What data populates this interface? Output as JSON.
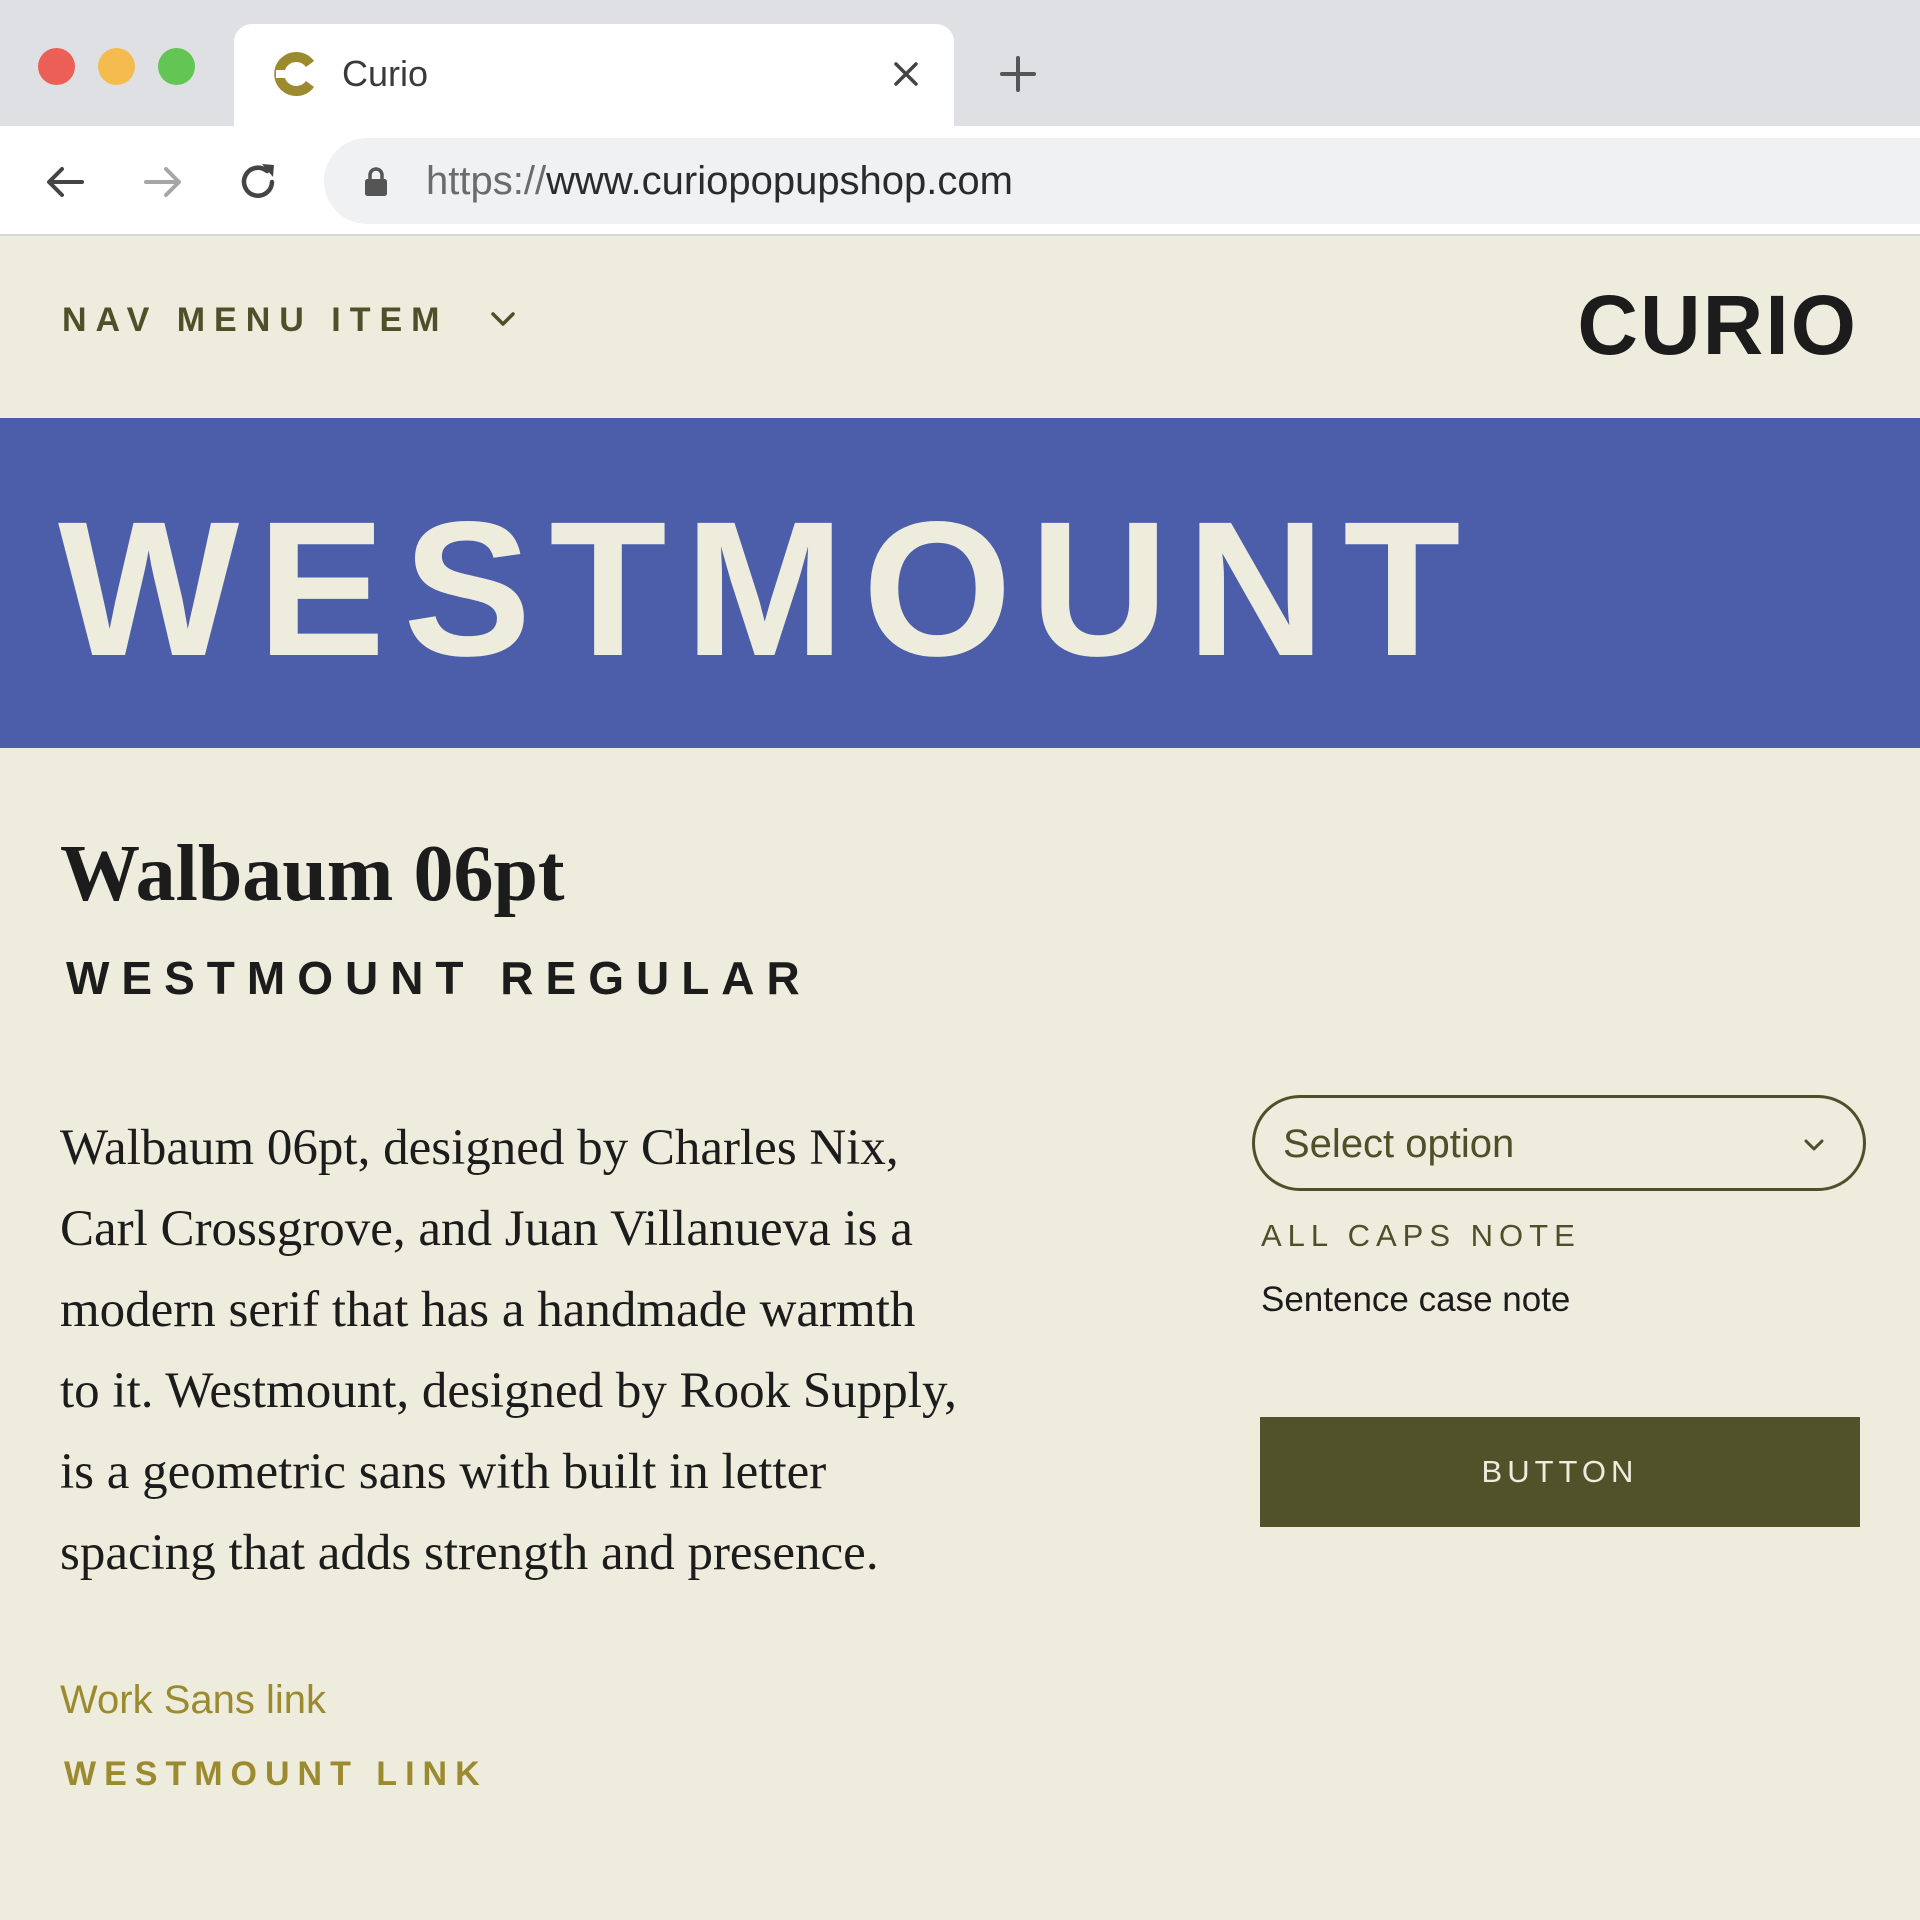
{
  "browser": {
    "tab": {
      "title": "Curio",
      "favicon": "curio-c-icon"
    },
    "omnibox": {
      "scheme": "https://",
      "host": "www.curiopopupshop.com"
    },
    "icons": [
      "back-arrow-icon",
      "forward-arrow-icon",
      "reload-icon",
      "lock-icon",
      "close-icon",
      "plus-icon"
    ]
  },
  "header": {
    "nav_item": "NAV MENU ITEM",
    "logo": "CURIO"
  },
  "hero": {
    "title": "WESTMOUNT"
  },
  "main": {
    "heading": "Walbaum 06pt",
    "subheading": "WESTMOUNT REGULAR",
    "body_lines": [
      "Walbaum 06pt, designed by Charles Nix,",
      "Carl Crossgrove, and Juan Villanueva is a",
      "modern serif that has a handmade warmth",
      "to it. Westmount, designed by Rook Supply,",
      "is a geometric sans with built in letter",
      "spacing that adds strength and presence."
    ],
    "link_sans": "Work Sans link",
    "link_caps": "WESTMOUNT LINK"
  },
  "sidebar": {
    "select_label": "Select option",
    "caps_note": "ALL CAPS NOTE",
    "sentence_note": "Sentence case note",
    "button_label": "BUTTON"
  },
  "colors": {
    "page_bg": "#edecdd",
    "hero_bg": "#4c5ea9",
    "accent_olive": "#52522a",
    "link_gold": "#9c8a2e",
    "text_dark": "#1c1c1c"
  }
}
